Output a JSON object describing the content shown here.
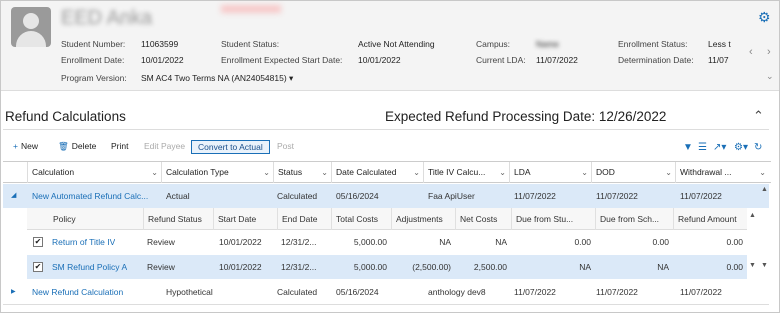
{
  "student": {
    "name": "EED Anka",
    "fields": [
      {
        "label": "Student Number:",
        "value": "11063599"
      },
      {
        "label": "Enrollment Date:",
        "value": "10/01/2022"
      },
      {
        "label": "Program Version:",
        "value": "SM AC4 Two Terms NA (AN24054815)"
      },
      {
        "label": "Student Status:",
        "value": "Active Not Attending"
      },
      {
        "label": "Enrollment Expected Start Date:",
        "value": "10/01/2022"
      },
      {
        "label": "Campus:",
        "value": "Name"
      },
      {
        "label": "Current LDA:",
        "value": "11/07/2022"
      },
      {
        "label": "Enrollment Status:",
        "value": "Less t"
      },
      {
        "label": "Determination Date:",
        "value": "11/07"
      }
    ]
  },
  "refund": {
    "title": "Refund Calculations",
    "processing_date": "Expected Refund Processing Date: 12/26/2022",
    "toolbar": {
      "new": "New",
      "delete": "Delete",
      "print": "Print",
      "edit_payee": "Edit Payee",
      "convert": "Convert to Actual",
      "post": "Post"
    },
    "columns": [
      "Calculation",
      "Calculation Type",
      "Status",
      "Date Calculated",
      "Title IV Calcu...",
      "LDA",
      "DOD",
      "Withdrawal ..."
    ],
    "rows": [
      {
        "calculation": "New Automated Refund Calc...",
        "type": "Actual",
        "status": "Calculated",
        "date": "05/16/2024",
        "title_iv": "Faa ApiUser",
        "lda": "11/07/2022",
        "dod": "11/07/2022",
        "withdrawal": "11/07/2022"
      },
      {
        "calculation": "New Refund Calculation",
        "type": "Hypothetical",
        "status": "Calculated",
        "date": "05/16/2024",
        "title_iv": "anthology dev8",
        "lda": "11/07/2022",
        "dod": "11/07/2022",
        "withdrawal": "11/07/2022"
      }
    ],
    "sub_columns": [
      "Policy",
      "Refund Status",
      "Start Date",
      "End Date",
      "Total Costs",
      "Adjustments",
      "Net Costs",
      "Due from Stu...",
      "Due from Sch...",
      "Refund Amount"
    ],
    "sub_rows": [
      {
        "checked": true,
        "policy": "Return of Title IV",
        "status": "Review",
        "start": "10/01/2022",
        "end": "12/31/2...",
        "total": "5,000.00",
        "adjust": "NA",
        "net": "NA",
        "due_stu": "0.00",
        "due_sch": "0.00",
        "refund": "0.00"
      },
      {
        "checked": true,
        "policy": "SM Refund Policy A",
        "status": "Review",
        "start": "10/01/2022",
        "end": "12/31/2...",
        "total": "5,000.00",
        "adjust": "(2,500.00)",
        "net": "2,500.00",
        "due_stu": "NA",
        "due_sch": "NA",
        "refund": "0.00"
      }
    ]
  }
}
